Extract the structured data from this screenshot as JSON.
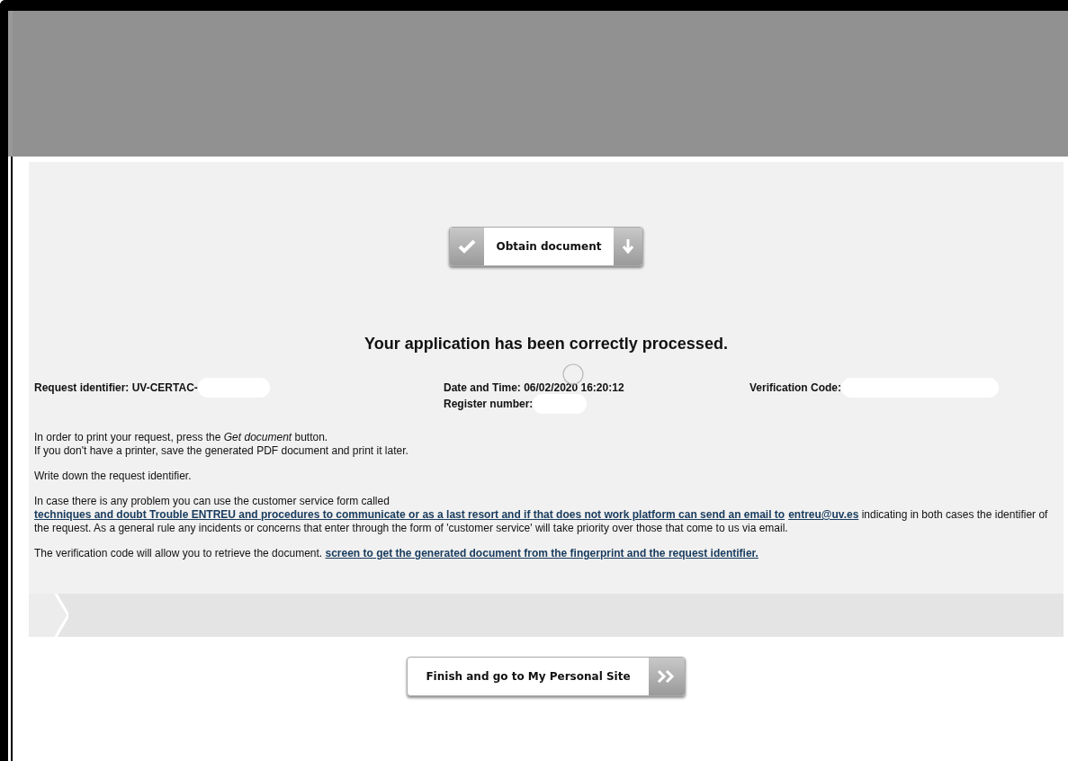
{
  "obtain_button": {
    "label": "Obtain document"
  },
  "heading": "Your application has been correctly processed.",
  "details": [
    [
      {
        "label": "Request identifier: UV-CERTAC-",
        "redacted": true
      }
    ],
    [
      {
        "label": "Date and Time: 06/02/2020 16:20:12",
        "redacted": false
      },
      {
        "label": "Register number:",
        "redacted": true
      }
    ],
    [
      {
        "label": "Verification Code:",
        "redacted": true
      }
    ]
  ],
  "paragraphs": [
    {
      "lines": [
        [
          {
            "kind": "text",
            "text": "In order to print your request, press the *Get document* button."
          }
        ],
        [
          {
            "kind": "text",
            "text": "If you don't have a printer, save the generated PDF document and print it later."
          }
        ]
      ]
    },
    {
      "lines": [
        [
          {
            "kind": "text",
            "text": "Write down the request identifier."
          }
        ]
      ]
    },
    {
      "lines": [
        [
          {
            "kind": "text",
            "text": "In case there is any problem you can use the customer service form called "
          },
          {
            "kind": "link",
            "text": "techniques and doubt Trouble ENTREU and procedures to communicate or as a last resort and if that does not work platform can send an email to"
          },
          {
            "kind": "link",
            "text": "entreu@uv.es"
          },
          {
            "kind": "text",
            "text": " indicating in both cases the identifier of the request. As a general rule any incidents or concerns that enter through the form of 'customer service' will take priority over those that come to us via email."
          }
        ]
      ]
    },
    {
      "lines": [
        [
          {
            "kind": "text",
            "text": "The verification code will allow you to retrieve the document. "
          },
          {
            "kind": "link",
            "text": "screen to get the generated document from the fingerprint and the request identifier."
          }
        ]
      ]
    }
  ],
  "finish_button": {
    "label": "Finish and go to My Personal Site"
  }
}
